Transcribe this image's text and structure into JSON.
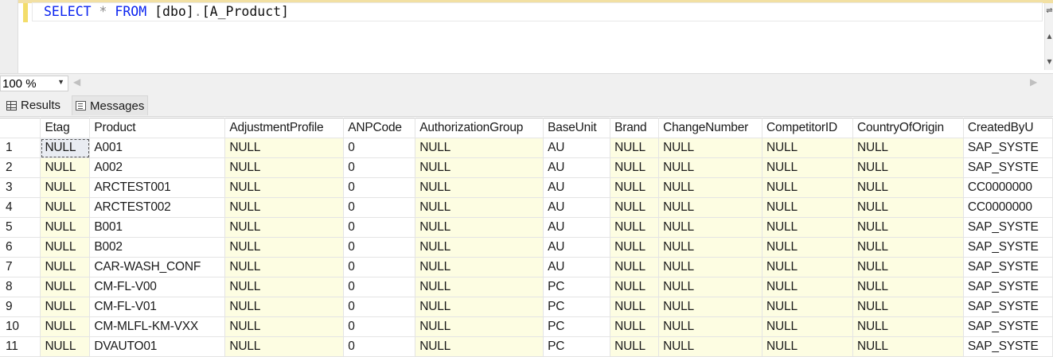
{
  "editor": {
    "tokens": {
      "select": "SELECT",
      "star": "*",
      "from": "FROM",
      "schema": "[dbo]",
      "dot": ".",
      "table": "[A_Product]"
    }
  },
  "zoom": {
    "value": "100 %"
  },
  "tabs": {
    "results": "Results",
    "messages": "Messages"
  },
  "grid": {
    "columns": [
      "",
      "Etag",
      "Product",
      "AdjustmentProfile",
      "ANPCode",
      "AuthorizationGroup",
      "BaseUnit",
      "Brand",
      "ChangeNumber",
      "CompetitorID",
      "CountryOfOrigin",
      "CreatedByU"
    ],
    "rows": [
      [
        "1",
        "NULL",
        "A001",
        "NULL",
        "0",
        "NULL",
        "AU",
        "NULL",
        "NULL",
        "NULL",
        "NULL",
        "SAP_SYSTE"
      ],
      [
        "2",
        "NULL",
        "A002",
        "NULL",
        "0",
        "NULL",
        "AU",
        "NULL",
        "NULL",
        "NULL",
        "NULL",
        "SAP_SYSTE"
      ],
      [
        "3",
        "NULL",
        "ARCTEST001",
        "NULL",
        "0",
        "NULL",
        "AU",
        "NULL",
        "NULL",
        "NULL",
        "NULL",
        "CC0000000"
      ],
      [
        "4",
        "NULL",
        "ARCTEST002",
        "NULL",
        "0",
        "NULL",
        "AU",
        "NULL",
        "NULL",
        "NULL",
        "NULL",
        "CC0000000"
      ],
      [
        "5",
        "NULL",
        "B001",
        "NULL",
        "0",
        "NULL",
        "AU",
        "NULL",
        "NULL",
        "NULL",
        "NULL",
        "SAP_SYSTE"
      ],
      [
        "6",
        "NULL",
        "B002",
        "NULL",
        "0",
        "NULL",
        "AU",
        "NULL",
        "NULL",
        "NULL",
        "NULL",
        "SAP_SYSTE"
      ],
      [
        "7",
        "NULL",
        "CAR-WASH_CONF",
        "NULL",
        "0",
        "NULL",
        "AU",
        "NULL",
        "NULL",
        "NULL",
        "NULL",
        "SAP_SYSTE"
      ],
      [
        "8",
        "NULL",
        "CM-FL-V00",
        "NULL",
        "0",
        "NULL",
        "PC",
        "NULL",
        "NULL",
        "NULL",
        "NULL",
        "SAP_SYSTE"
      ],
      [
        "9",
        "NULL",
        "CM-FL-V01",
        "NULL",
        "0",
        "NULL",
        "PC",
        "NULL",
        "NULL",
        "NULL",
        "NULL",
        "SAP_SYSTE"
      ],
      [
        "10",
        "NULL",
        "CM-MLFL-KM-VXX",
        "NULL",
        "0",
        "NULL",
        "PC",
        "NULL",
        "NULL",
        "NULL",
        "NULL",
        "SAP_SYSTE"
      ],
      [
        "11",
        "NULL",
        "DVAUTO01",
        "NULL",
        "0",
        "NULL",
        "PC",
        "NULL",
        "NULL",
        "NULL",
        "NULL",
        "SAP_SYSTE"
      ]
    ]
  },
  "colors": {
    "keyword": "#0b24f0",
    "null_cell_bg": "#fdfde2",
    "selected_cell_bg": "#e9ecf2"
  }
}
